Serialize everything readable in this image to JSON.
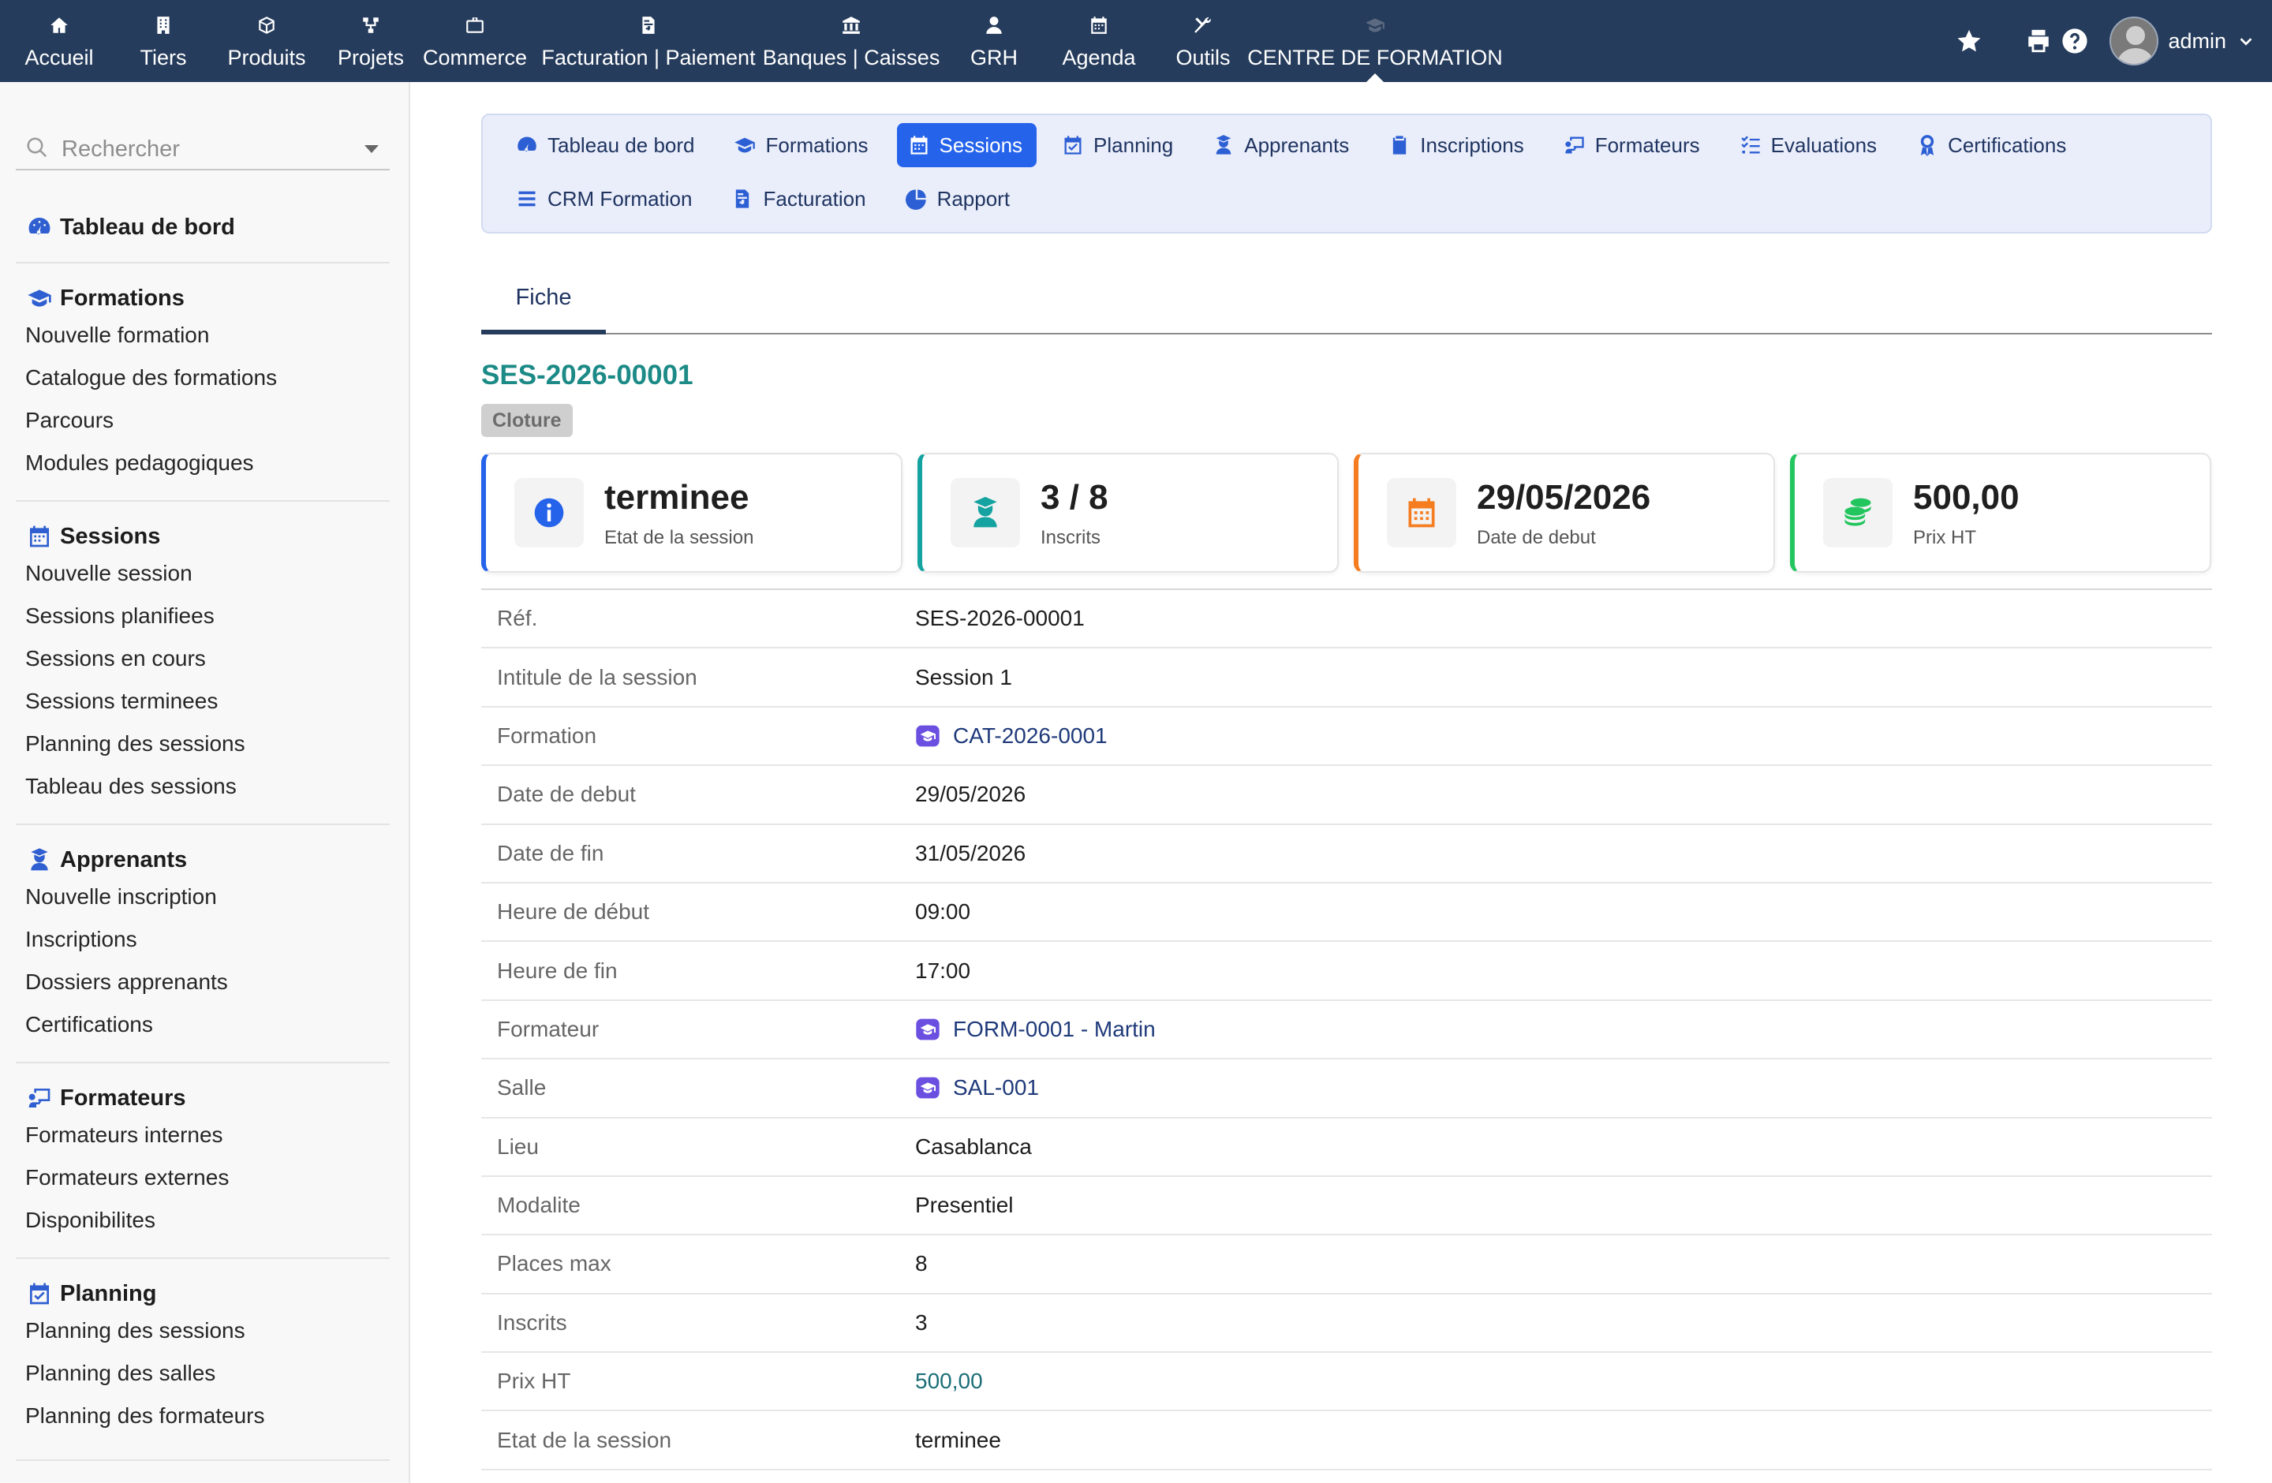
{
  "topnav": {
    "items": [
      {
        "label": "Accueil",
        "icon": "home-icon"
      },
      {
        "label": "Tiers",
        "icon": "building-icon"
      },
      {
        "label": "Produits",
        "icon": "cube-icon"
      },
      {
        "label": "Projets",
        "icon": "project-tree-icon"
      },
      {
        "label": "Commerce",
        "icon": "briefcase-icon"
      },
      {
        "label": "Facturation | Paiement",
        "icon": "invoice-icon"
      },
      {
        "label": "Banques | Caisses",
        "icon": "bank-icon"
      },
      {
        "label": "GRH",
        "icon": "user-tie-icon"
      },
      {
        "label": "Agenda",
        "icon": "calendar-icon"
      },
      {
        "label": "Outils",
        "icon": "tools-icon"
      },
      {
        "label": "CENTRE DE FORMATION",
        "icon": "graduation-cap-icon"
      }
    ],
    "user_name": "admin"
  },
  "sidebar": {
    "search_placeholder": "Rechercher",
    "dashboard_label": "Tableau de bord",
    "groups": [
      {
        "title": "Formations",
        "items": [
          "Nouvelle formation",
          "Catalogue des formations",
          "Parcours",
          "Modules pedagogiques"
        ]
      },
      {
        "title": "Sessions",
        "items": [
          "Nouvelle session",
          "Sessions planifiees",
          "Sessions en cours",
          "Sessions terminees",
          "Planning des sessions",
          "Tableau des sessions"
        ]
      },
      {
        "title": "Apprenants",
        "items": [
          "Nouvelle inscription",
          "Inscriptions",
          "Dossiers apprenants",
          "Certifications"
        ]
      },
      {
        "title": "Formateurs",
        "items": [
          "Formateurs internes",
          "Formateurs externes",
          "Disponibilites"
        ]
      },
      {
        "title": "Planning",
        "items": [
          "Planning des sessions",
          "Planning des salles",
          "Planning des formateurs"
        ]
      }
    ]
  },
  "modnav": {
    "row1": [
      "Tableau de bord",
      "Formations",
      "Sessions",
      "Planning",
      "Apprenants",
      "Inscriptions",
      "Formateurs",
      "Evaluations",
      "Certifications"
    ],
    "row2": [
      "CRM Formation",
      "Facturation",
      "Rapport"
    ],
    "active": "Sessions"
  },
  "tabs": {
    "fiche": "Fiche"
  },
  "record": {
    "ref": "SES-2026-00001",
    "status": "Cloture"
  },
  "cards": [
    {
      "value": "terminee",
      "label": "Etat de la session",
      "color": "#2563eb",
      "icon": "info-circle-icon"
    },
    {
      "value": "3 / 8",
      "label": "Inscrits",
      "color": "#14a3a0",
      "icon": "graduate-icon"
    },
    {
      "value": "29/05/2026",
      "label": "Date de debut",
      "color": "#f57c1f",
      "icon": "calendar-icon"
    },
    {
      "value": "500,00",
      "label": "Prix HT",
      "color": "#22c55e",
      "icon": "coins-icon"
    }
  ],
  "fields": [
    {
      "label": "Réf.",
      "value": "SES-2026-00001"
    },
    {
      "label": "Intitule de la session",
      "value": "Session 1"
    },
    {
      "label": "Formation",
      "value": "CAT-2026-0001"
    },
    {
      "label": "Date de debut",
      "value": "29/05/2026"
    },
    {
      "label": "Date de fin",
      "value": "31/05/2026"
    },
    {
      "label": "Heure de début",
      "value": "09:00"
    },
    {
      "label": "Heure de fin",
      "value": "17:00"
    },
    {
      "label": "Formateur",
      "value": "FORM-0001 - Martin"
    },
    {
      "label": "Salle",
      "value": "SAL-001"
    },
    {
      "label": "Lieu",
      "value": "Casablanca"
    },
    {
      "label": "Modalite",
      "value": "Presentiel"
    },
    {
      "label": "Places max",
      "value": "8"
    },
    {
      "label": "Inscrits",
      "value": "3"
    },
    {
      "label": "Prix HT",
      "value": "500,00"
    },
    {
      "label": "Etat de la session",
      "value": "terminee"
    }
  ]
}
